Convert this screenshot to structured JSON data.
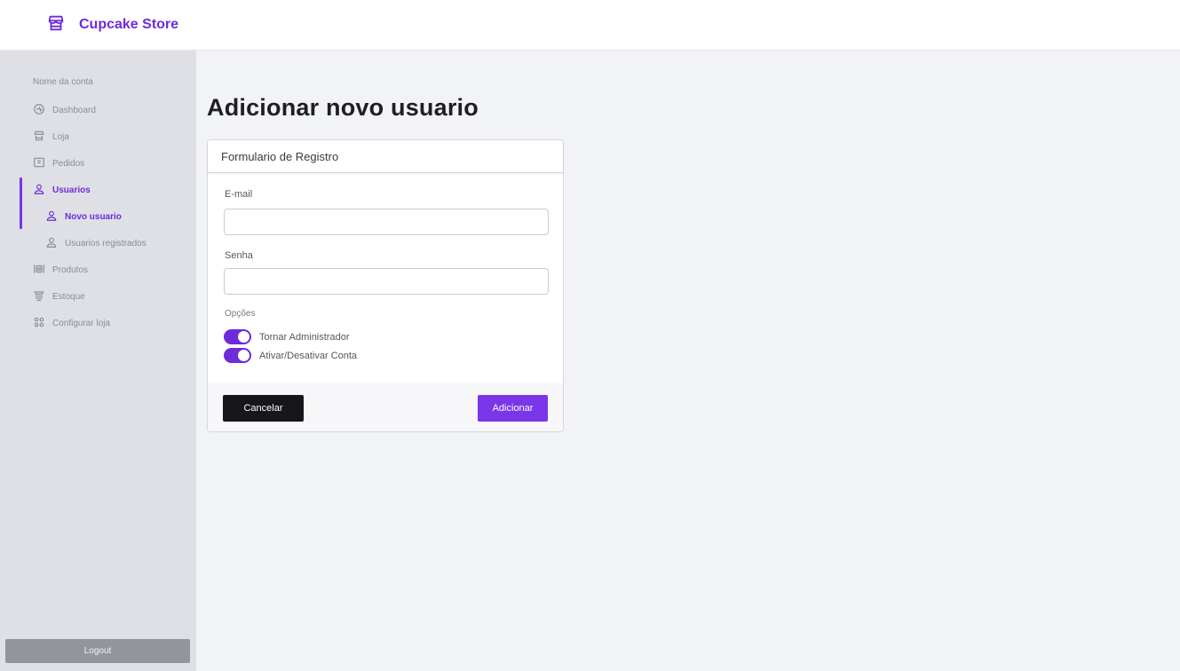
{
  "header": {
    "brand_name": "Cupcake Store",
    "brand_icon": "store-icon",
    "accent_color": "#6d2bd9"
  },
  "sidebar": {
    "account_name": "Nome da conta",
    "items": [
      {
        "label": "Dashboard",
        "icon": "dashboard-icon",
        "active": false
      },
      {
        "label": "Loja",
        "icon": "store-icon",
        "active": false
      },
      {
        "label": "Pedidos",
        "icon": "orders-icon",
        "active": false
      },
      {
        "label": "Usuarios",
        "icon": "user-icon",
        "active": true
      },
      {
        "label": "Novo usuario",
        "icon": "user-icon",
        "active": true,
        "sub": true
      },
      {
        "label": "Usuarios registrados",
        "icon": "user-icon",
        "active": false,
        "sub": true
      },
      {
        "label": "Produtos",
        "icon": "products-icon",
        "active": false
      },
      {
        "label": "Estoque",
        "icon": "stock-icon",
        "active": false
      },
      {
        "label": "Configurar loja",
        "icon": "settings-icon",
        "active": false
      }
    ],
    "logout_label": "Logout"
  },
  "main": {
    "title": "Adicionar novo usuario",
    "form": {
      "header": "Formulario de Registro",
      "email_label": "E-mail",
      "email_value": "",
      "password_label": "Senha",
      "password_value": "",
      "options_label": "Opções",
      "toggles": [
        {
          "label": "Tornar Administrador",
          "on": true
        },
        {
          "label": "Ativar/Desativar Conta",
          "on": true
        }
      ],
      "cancel_label": "Cancelar",
      "submit_label": "Adicionar"
    }
  }
}
